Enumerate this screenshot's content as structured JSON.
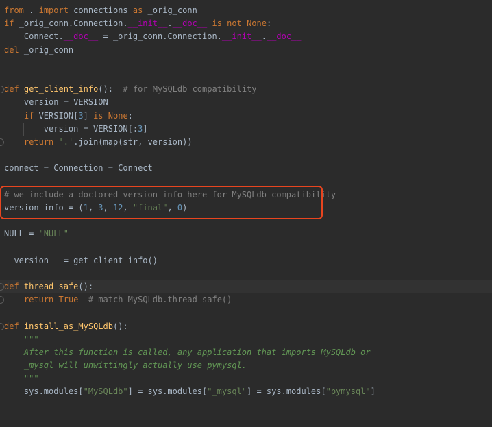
{
  "editor": {
    "lines": [
      {
        "tokens": [
          {
            "c": "kw",
            "t": "from"
          },
          {
            "c": "plain",
            "t": " . "
          },
          {
            "c": "kw",
            "t": "import"
          },
          {
            "c": "plain",
            "t": " connections "
          },
          {
            "c": "kw",
            "t": "as"
          },
          {
            "c": "plain",
            "t": " _orig_conn"
          }
        ]
      },
      {
        "tokens": [
          {
            "c": "kw",
            "t": "if"
          },
          {
            "c": "plain",
            "t": " _orig_conn.Connection."
          },
          {
            "c": "dunder",
            "t": "__init__"
          },
          {
            "c": "plain",
            "t": "."
          },
          {
            "c": "dunder",
            "t": "__doc__"
          },
          {
            "c": "plain",
            "t": " "
          },
          {
            "c": "kw",
            "t": "is not"
          },
          {
            "c": "plain",
            "t": " "
          },
          {
            "c": "kw",
            "t": "None"
          },
          {
            "c": "plain",
            "t": ":"
          }
        ]
      },
      {
        "tokens": [
          {
            "c": "plain",
            "t": "    Connect."
          },
          {
            "c": "dunder",
            "t": "__doc__"
          },
          {
            "c": "plain",
            "t": " = _orig_conn.Connection."
          },
          {
            "c": "dunder",
            "t": "__init__"
          },
          {
            "c": "plain",
            "t": "."
          },
          {
            "c": "dunder",
            "t": "__doc__"
          }
        ]
      },
      {
        "tokens": [
          {
            "c": "kw",
            "t": "del"
          },
          {
            "c": "plain",
            "t": " _orig_conn"
          }
        ]
      },
      {
        "tokens": []
      },
      {
        "tokens": []
      },
      {
        "fold": true,
        "tokens": [
          {
            "c": "kw",
            "t": "def"
          },
          {
            "c": "plain",
            "t": " "
          },
          {
            "c": "fn",
            "t": "get_client_info"
          },
          {
            "c": "plain",
            "t": "():  "
          },
          {
            "c": "cm",
            "t": "# for MySQLdb compatibility"
          }
        ]
      },
      {
        "tokens": [
          {
            "c": "plain",
            "t": "    version = VERSION"
          }
        ]
      },
      {
        "tokens": [
          {
            "c": "plain",
            "t": "    "
          },
          {
            "c": "kw",
            "t": "if"
          },
          {
            "c": "plain",
            "t": " VERSION["
          },
          {
            "c": "num",
            "t": "3"
          },
          {
            "c": "plain",
            "t": "] "
          },
          {
            "c": "kw",
            "t": "is"
          },
          {
            "c": "plain",
            "t": " "
          },
          {
            "c": "kw",
            "t": "None"
          },
          {
            "c": "plain",
            "t": ":"
          }
        ]
      },
      {
        "guide": true,
        "tokens": [
          {
            "c": "plain",
            "t": "        version = VERSION[:"
          },
          {
            "c": "num",
            "t": "3"
          },
          {
            "c": "plain",
            "t": "]"
          }
        ]
      },
      {
        "fold": true,
        "tokens": [
          {
            "c": "plain",
            "t": "    "
          },
          {
            "c": "kw",
            "t": "return"
          },
          {
            "c": "plain",
            "t": " "
          },
          {
            "c": "str",
            "t": "'.'"
          },
          {
            "c": "plain",
            "t": ".join(map(str, version))"
          }
        ]
      },
      {
        "tokens": []
      },
      {
        "tokens": [
          {
            "c": "plain",
            "t": "connect = Connection = Connect"
          }
        ]
      },
      {
        "tokens": []
      },
      {
        "tokens": [
          {
            "c": "cm",
            "t": "# we include a doctored version_info here for MySQLdb compatibility"
          }
        ]
      },
      {
        "tokens": [
          {
            "c": "plain",
            "t": "version_info = ("
          },
          {
            "c": "num",
            "t": "1"
          },
          {
            "c": "plain",
            "t": ", "
          },
          {
            "c": "num",
            "t": "3"
          },
          {
            "c": "plain",
            "t": ", "
          },
          {
            "c": "num",
            "t": "12"
          },
          {
            "c": "plain",
            "t": ", "
          },
          {
            "c": "str",
            "t": "\"final\""
          },
          {
            "c": "plain",
            "t": ", "
          },
          {
            "c": "num",
            "t": "0"
          },
          {
            "c": "plain",
            "t": ")"
          }
        ]
      },
      {
        "tokens": []
      },
      {
        "tokens": [
          {
            "c": "plain",
            "t": "NULL = "
          },
          {
            "c": "str",
            "t": "\"NULL\""
          }
        ]
      },
      {
        "tokens": []
      },
      {
        "tokens": [
          {
            "c": "plain",
            "t": "__version__ = get_client_info()"
          }
        ]
      },
      {
        "tokens": []
      },
      {
        "fold": true,
        "hl": true,
        "tokens": [
          {
            "c": "kw",
            "t": "def"
          },
          {
            "c": "plain",
            "t": " "
          },
          {
            "c": "fn",
            "t": "thread_safe"
          },
          {
            "c": "plain",
            "t": "():"
          }
        ]
      },
      {
        "fold": true,
        "tokens": [
          {
            "c": "plain",
            "t": "    "
          },
          {
            "c": "kw",
            "t": "return"
          },
          {
            "c": "plain",
            "t": " "
          },
          {
            "c": "kw",
            "t": "True"
          },
          {
            "c": "plain",
            "t": "  "
          },
          {
            "c": "cm",
            "t": "# match MySQLdb.thread_safe()"
          }
        ]
      },
      {
        "tokens": []
      },
      {
        "fold": true,
        "tokens": [
          {
            "c": "kw",
            "t": "def"
          },
          {
            "c": "plain",
            "t": " "
          },
          {
            "c": "fn",
            "t": "install_as_MySQLdb"
          },
          {
            "c": "plain",
            "t": "():"
          }
        ]
      },
      {
        "tokens": [
          {
            "c": "doc",
            "t": "    \"\"\""
          }
        ]
      },
      {
        "tokens": [
          {
            "c": "doc",
            "t": "    After this function is called, any application that imports MySQLdb or"
          }
        ]
      },
      {
        "tokens": [
          {
            "c": "doc",
            "t": "    _mysql will unwittingly actually use pymysql."
          }
        ]
      },
      {
        "tokens": [
          {
            "c": "doc",
            "t": "    \"\"\""
          }
        ]
      },
      {
        "tokens": [
          {
            "c": "plain",
            "t": "    sys.modules["
          },
          {
            "c": "str",
            "t": "\"MySQLdb\""
          },
          {
            "c": "plain",
            "t": "] = sys.modules["
          },
          {
            "c": "str",
            "t": "\"_mysql\""
          },
          {
            "c": "plain",
            "t": "] = sys.modules["
          },
          {
            "c": "str",
            "t": "\"pymysql\""
          },
          {
            "c": "plain",
            "t": "]"
          }
        ]
      },
      {
        "tokens": []
      },
      {
        "tokens": []
      }
    ]
  },
  "colors": {
    "background": "#2b2b2b",
    "keyword": "#cc7832",
    "string": "#6a8759",
    "number": "#6897bb",
    "comment": "#808080",
    "dunder": "#b200b2",
    "function": "#ffc66d",
    "docstring": "#629755",
    "highlight_box": "#e8451f"
  }
}
